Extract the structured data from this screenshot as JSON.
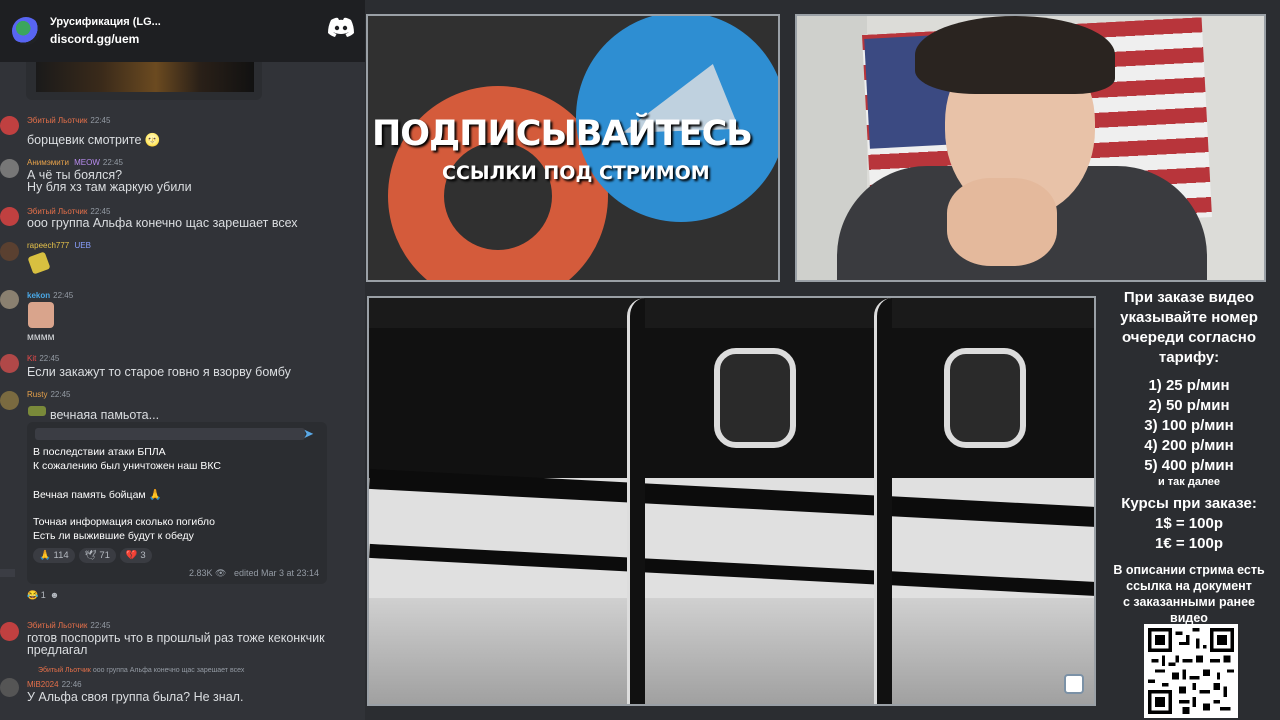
{
  "server": {
    "name": "Урусификация (LG...",
    "invite": "discord.gg/uem"
  },
  "messages": [
    {
      "user": "Эбитый Льотчик",
      "time": "22:45",
      "lines": [
        "борщевик смотрите 🌝"
      ],
      "color": "#e6704a"
    },
    {
      "user": "Анимэмити",
      "time": "22:45",
      "badge": "MEOW",
      "lines": [
        "А чё ты боялся?",
        "Ну бля хз там жаркую убили"
      ],
      "color": "#e6a14a"
    },
    {
      "user": "Эбитый Льотчик",
      "time": "22:45",
      "lines": [
        "ооо группа Альфа конечно щас зарешает всех"
      ],
      "color": "#e6704a"
    },
    {
      "user": "rapeech777",
      "time": "",
      "badge": "UEB",
      "lines": [
        ""
      ],
      "color": "#e6c24a"
    },
    {
      "user": "kekon",
      "time": "22:45",
      "lines": [
        "мммм"
      ],
      "color": "#4aa8e6"
    },
    {
      "user": "Kit",
      "time": "22:45",
      "lines": [
        "Если закажут то старое говно я взорву бомбу"
      ],
      "color": "#e64a4a"
    },
    {
      "user": "Rusty",
      "time": "22:45",
      "lines": [
        "вечнаяа памьота..."
      ],
      "color": "#e6a14a"
    },
    {
      "user": "Эбитый Льотчик",
      "time": "22:45",
      "lines": [
        "готов поспорить что в прошлый раз тоже кеконкчик",
        "предлагал"
      ],
      "color": "#e6704a"
    },
    {
      "user": "MiB2024",
      "time": "22:46",
      "reply": "ооо группа Альфа конечно щас зарешает всех",
      "lines": [
        "У Альфа своя группа была? Не знал."
      ],
      "color": "#e6704a"
    }
  ],
  "telegram_card": {
    "lines": [
      "В последствии атаки БПЛА",
      "К сожалению был уничтожен наш ВКС",
      "",
      "Вечная память бойцам 🙏",
      "",
      "Точная информация сколько погибло",
      "Есть ли выжившие будут к обеду"
    ],
    "reactions": [
      {
        "emoji": "🙏",
        "count": "114"
      },
      {
        "emoji": "🕊",
        "count": "71"
      },
      {
        "emoji": "💔",
        "count": "3"
      }
    ],
    "views": "2.83K",
    "edited": "edited Mar 3 at 23:14"
  },
  "message_reactions": [
    {
      "emoji": "😂",
      "count": "1"
    },
    {
      "emoji": "☻",
      "count": ""
    }
  ],
  "promo": {
    "title": "ПОДПИСЫВАЙТЕСЬ",
    "subtitle": "ССЫЛКИ ПОД СТРИМОМ"
  },
  "info": {
    "intro": [
      "При заказе видео",
      "указывайте номер",
      "очереди согласно",
      "тарифу:"
    ],
    "tariffs": [
      "1) 25 р/мин",
      "2) 50 р/мин",
      "3) 100 р/мин",
      "4) 200 р/мин",
      "5) 400 р/мин"
    ],
    "etc": "и так далее",
    "rates_title": "Курсы при заказе:",
    "rates": [
      "1$ = 100р",
      "1€ = 100р"
    ],
    "outro": [
      "В описании стрима есть",
      "ссылка на документ",
      "с заказанными ранее",
      "видео"
    ]
  }
}
